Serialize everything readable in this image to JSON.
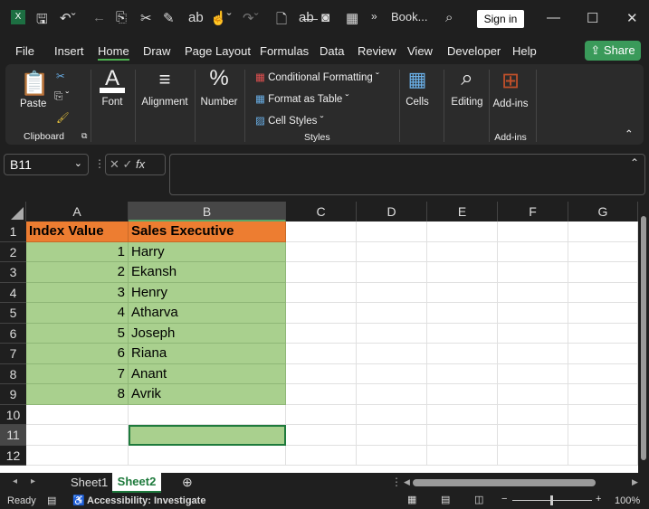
{
  "titlebar": {
    "filename": "Book...",
    "sign_in": "Sign in"
  },
  "menu": [
    "File",
    "Insert",
    "Home",
    "Draw",
    "Page Layout",
    "Formulas",
    "Data",
    "Review",
    "View",
    "Developer",
    "Help"
  ],
  "share": "Share",
  "ribbon": {
    "paste": "Paste",
    "clipboard": "Clipboard",
    "font": "Font",
    "alignment": "Alignment",
    "number": "Number",
    "conditional_formatting": "Conditional Formatting",
    "format_as_table": "Format as Table",
    "cell_styles": "Cell Styles",
    "styles": "Styles",
    "cells": "Cells",
    "editing": "Editing",
    "addins": "Add-ins",
    "addins_group": "Add-ins"
  },
  "formula_bar": {
    "name_box": "B11",
    "fx": "fx",
    "value": ""
  },
  "columns": [
    "A",
    "B",
    "C",
    "D",
    "E",
    "F",
    "G"
  ],
  "rows": [
    "1",
    "2",
    "3",
    "4",
    "5",
    "6",
    "7",
    "8",
    "9",
    "10",
    "11",
    "12"
  ],
  "table": {
    "headers": [
      "Index Value",
      "Sales Executive"
    ],
    "data": [
      [
        "1",
        "Harry"
      ],
      [
        "2",
        "Ekansh"
      ],
      [
        "3",
        "Henry"
      ],
      [
        "4",
        "Atharva"
      ],
      [
        "5",
        "Joseph"
      ],
      [
        "6",
        "Riana"
      ],
      [
        "7",
        "Anant"
      ],
      [
        "8",
        "Avrik"
      ]
    ]
  },
  "selected_cell": "B11",
  "sheets": [
    "Sheet1",
    "Sheet2"
  ],
  "active_sheet": "Sheet2",
  "status": {
    "ready": "Ready",
    "accessibility": "Accessibility: Investigate",
    "zoom": "100%"
  },
  "colors": {
    "header_fill": "#ed7d31",
    "data_fill": "#a9d08e",
    "accent": "#3a9a5a"
  }
}
